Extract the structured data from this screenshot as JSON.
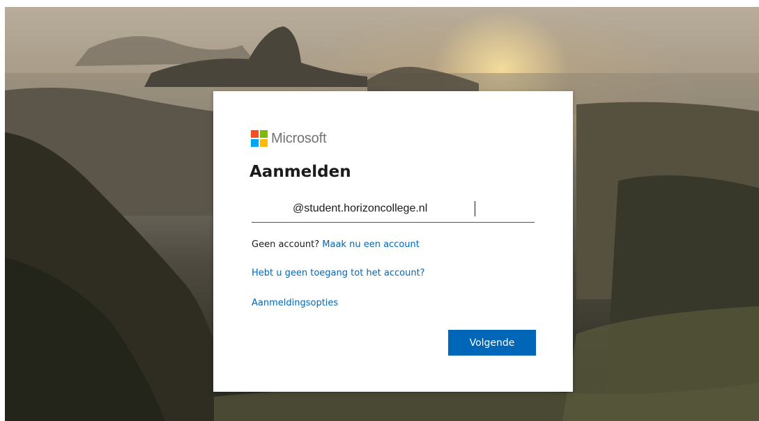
{
  "brand": {
    "name": "Microsoft"
  },
  "signin": {
    "title": "Aanmelden",
    "email_value": "@student.horizoncollege.nl",
    "no_account_text": "Geen account?",
    "create_account_link": "Maak nu een account",
    "no_access_link": "Hebt u geen toegang tot het account?",
    "signin_options_link": "Aanmeldingsopties",
    "next_button": "Volgende"
  },
  "colors": {
    "accent": "#0067b8",
    "logo_red": "#f25022",
    "logo_green": "#7fba00",
    "logo_blue": "#00a4ef",
    "logo_yellow": "#ffb900"
  }
}
